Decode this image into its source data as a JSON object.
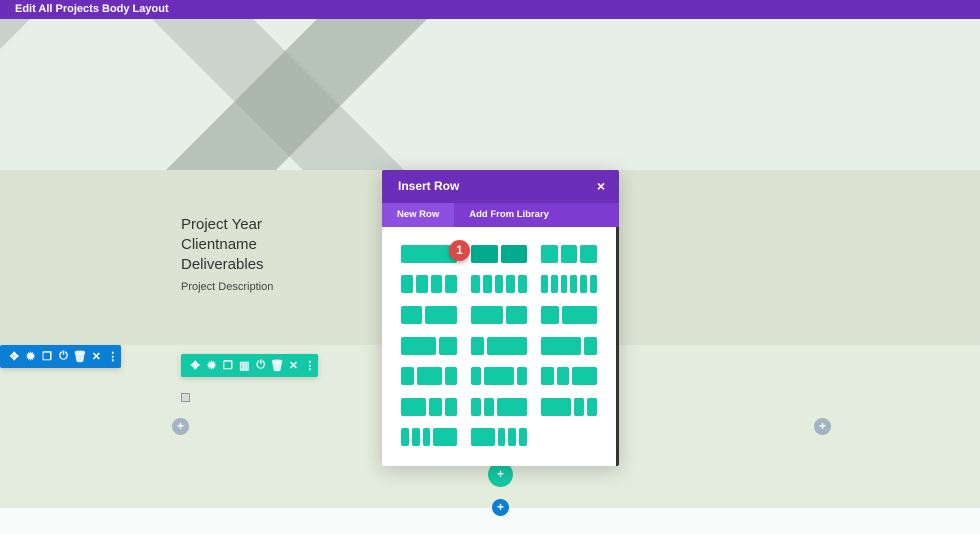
{
  "topbar": {
    "title": "Edit All Projects Body Layout"
  },
  "content": {
    "project_year": "Project Year",
    "client_name": "Clientname",
    "deliverables": "Deliverables",
    "description": "Project Description"
  },
  "section_toolbar": {
    "color": "#0b7fd6",
    "icons": [
      "move-icon",
      "gear-icon",
      "duplicate-icon",
      "power-icon",
      "trash-icon",
      "close-icon",
      "more-icon"
    ]
  },
  "row_toolbar": {
    "color": "#13c9a5",
    "icons": [
      "move-icon",
      "gear-icon",
      "duplicate-icon",
      "columns-icon",
      "power-icon",
      "trash-icon",
      "close-icon",
      "more-icon"
    ]
  },
  "modal": {
    "title": "Insert Row",
    "close": "×",
    "tabs": [
      {
        "label": "New Row",
        "active": true
      },
      {
        "label": "Add From Library",
        "active": false
      }
    ],
    "badge": "1",
    "layouts": [
      [
        1
      ],
      [
        1,
        1
      ],
      [
        1,
        1,
        1
      ],
      [
        1,
        1,
        1,
        1
      ],
      [
        1,
        1,
        1,
        1,
        1
      ],
      [
        1,
        1,
        1,
        1,
        1,
        1
      ],
      [
        2,
        3
      ],
      [
        3,
        2
      ],
      [
        1,
        2
      ],
      [
        2,
        1
      ],
      [
        1,
        3
      ],
      [
        3,
        1
      ],
      [
        1,
        2,
        1
      ],
      [
        1,
        3,
        1
      ],
      [
        1,
        1,
        2
      ],
      [
        2,
        1,
        1
      ],
      [
        1,
        1,
        3
      ],
      [
        3,
        1,
        1
      ],
      [
        1,
        1,
        1,
        3
      ],
      [
        3,
        1,
        1,
        1
      ]
    ],
    "hovered_layout": 1
  },
  "colors": {
    "purple": "#6c2eb9",
    "teal": "#13c9a5",
    "blue": "#0b7fd6"
  }
}
